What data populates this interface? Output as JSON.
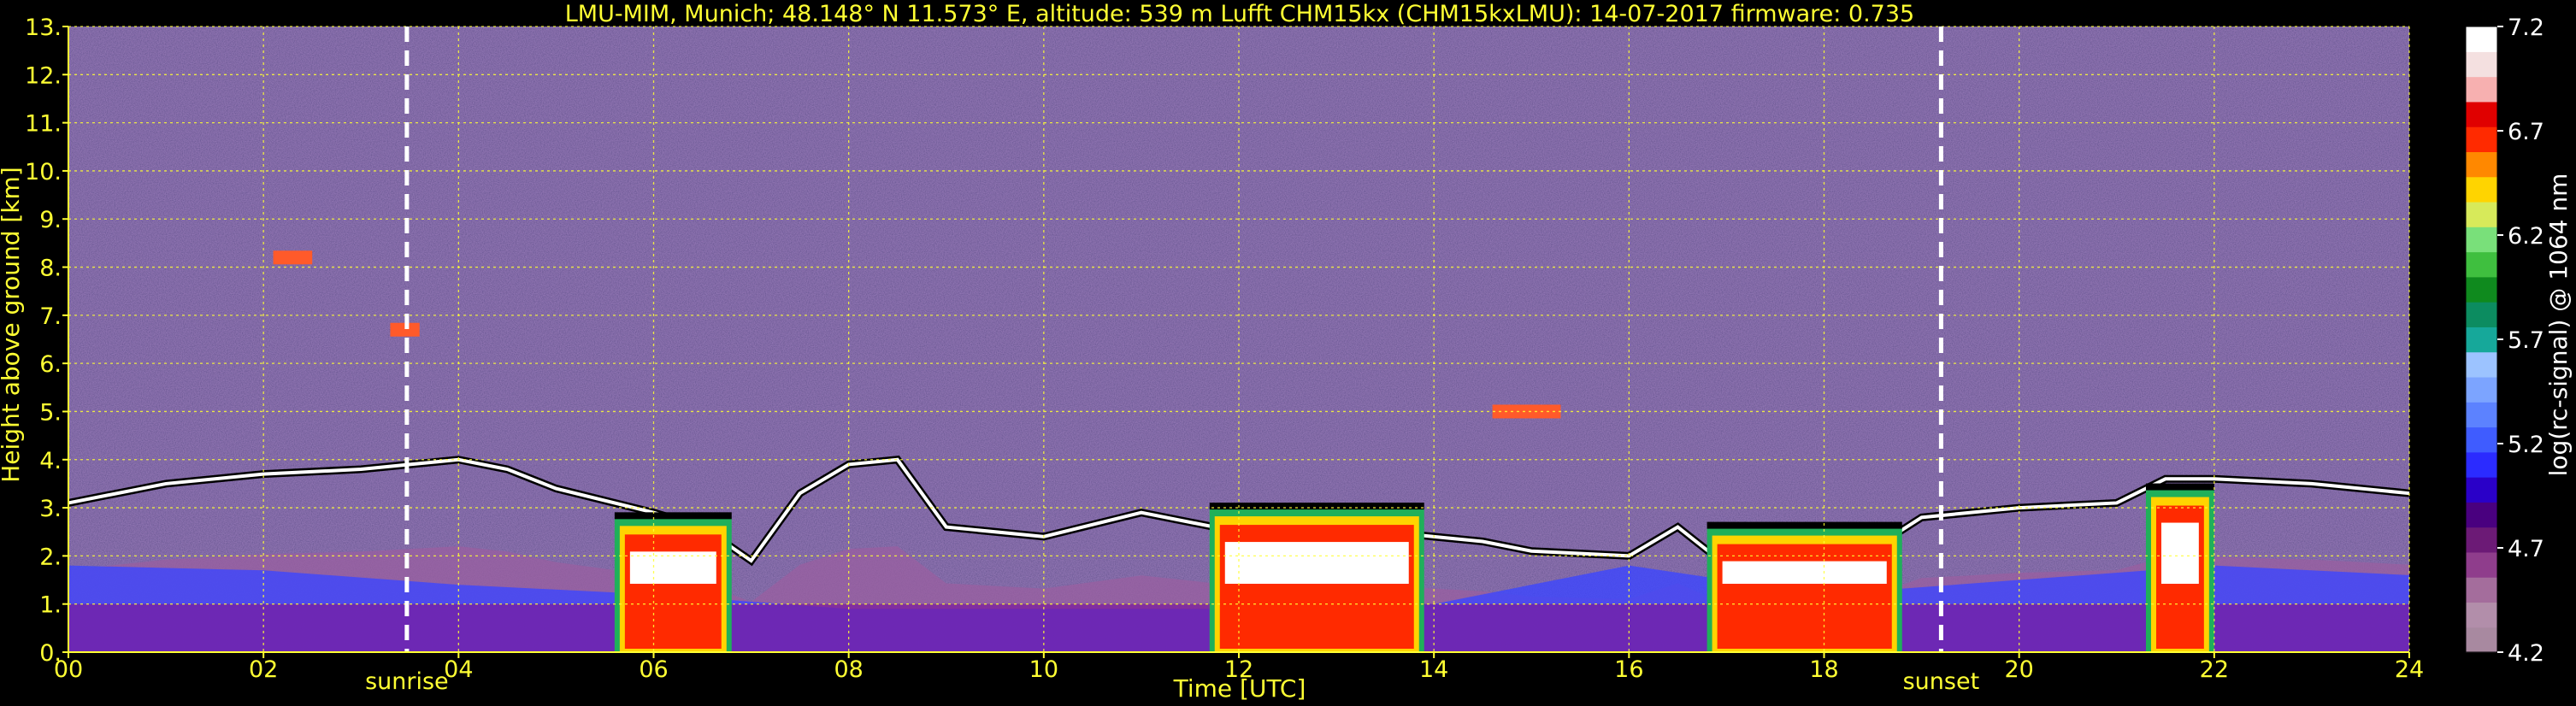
{
  "chart_data": {
    "type": "heatmap",
    "title": "LMU-MIM, Munich; 48.148° N 11.573° E, altitude: 539 m     Lufft CHM15kx (CHM15kxLMU): 14-07-2017     firmware: 0.735",
    "xlabel": "Time [UTC]",
    "ylabel": "Height above ground [km]",
    "xlim": [
      0,
      24
    ],
    "ylim": [
      0,
      13
    ],
    "x_ticks": [
      "00",
      "02",
      "04",
      "06",
      "08",
      "10",
      "12",
      "14",
      "16",
      "18",
      "20",
      "22",
      "24"
    ],
    "x_tick_values": [
      0,
      2,
      4,
      6,
      8,
      10,
      12,
      14,
      16,
      18,
      20,
      22,
      24
    ],
    "y_ticks": [
      "0.",
      "1.",
      "2.",
      "3.",
      "4.",
      "5.",
      "6.",
      "7.",
      "8.",
      "9.",
      "10.",
      "11.",
      "12.",
      "13."
    ],
    "y_tick_values": [
      0,
      1,
      2,
      3,
      4,
      5,
      6,
      7,
      8,
      9,
      10,
      11,
      12,
      13
    ],
    "grid": true,
    "annotations": [
      {
        "label": "sunrise",
        "x": 3.47
      },
      {
        "label": "sunset",
        "x": 19.2
      }
    ],
    "colorbar": {
      "label": "log(rc-signal) @ 1064 nm",
      "min": 4.2,
      "max": 7.2,
      "ticks": [
        "4.2",
        "4.7",
        "5.2",
        "5.7",
        "6.2",
        "6.7",
        "7.2"
      ],
      "tick_values": [
        4.2,
        4.7,
        5.2,
        5.7,
        6.2,
        6.7,
        7.2
      ],
      "colors": [
        "#a889a0",
        "#b28eaa",
        "#a46d9c",
        "#8f3d8c",
        "#6c1a76",
        "#49007f",
        "#2a00c8",
        "#2b2bff",
        "#3f5cff",
        "#5c82ff",
        "#7ca4ff",
        "#9cc3ff",
        "#16a89a",
        "#0c8c60",
        "#0f8a1e",
        "#3fbf3f",
        "#79e07a",
        "#d7ea5a",
        "#ffd400",
        "#ff8800",
        "#ff2a00",
        "#e00000",
        "#f7b0b0",
        "#f4e0e0",
        "#ffffff"
      ]
    },
    "features": {
      "boundary_layer_top_km": [
        [
          0,
          3.1
        ],
        [
          1,
          3.5
        ],
        [
          2,
          3.7
        ],
        [
          3,
          3.8
        ],
        [
          3.5,
          3.9
        ],
        [
          4,
          4.0
        ],
        [
          4.5,
          3.8
        ],
        [
          5,
          3.4
        ],
        [
          6,
          2.9
        ],
        [
          6.5,
          2.6
        ],
        [
          7,
          1.9
        ],
        [
          7.5,
          3.3
        ],
        [
          8,
          3.9
        ],
        [
          8.5,
          4.0
        ],
        [
          9,
          2.6
        ],
        [
          10,
          2.4
        ],
        [
          11,
          2.9
        ],
        [
          12,
          2.5
        ],
        [
          13,
          2.6
        ],
        [
          14,
          2.4
        ],
        [
          14.5,
          2.3
        ],
        [
          15,
          2.1
        ],
        [
          16,
          2.0
        ],
        [
          16.5,
          2.6
        ],
        [
          17,
          1.8
        ],
        [
          18,
          1.5
        ],
        [
          19,
          2.8
        ],
        [
          20,
          3.0
        ],
        [
          21,
          3.1
        ],
        [
          21.5,
          3.6
        ],
        [
          22,
          3.6
        ],
        [
          23,
          3.5
        ],
        [
          24,
          3.3
        ]
      ],
      "cloud_events": [
        {
          "t0": 5.6,
          "t1": 6.8,
          "top_km": 2.8
        },
        {
          "t0": 11.7,
          "t1": 13.9,
          "top_km": 3.0
        },
        {
          "t0": 16.8,
          "t1": 18.8,
          "top_km": 2.6
        },
        {
          "t0": 21.3,
          "t1": 22.0,
          "top_km": 3.4
        }
      ],
      "elevated_layers": [
        {
          "t0": 2.1,
          "t1": 2.5,
          "h_km": 8.2
        },
        {
          "t0": 3.3,
          "t1": 3.6,
          "h_km": 6.7
        },
        {
          "t0": 14.6,
          "t1": 15.3,
          "h_km": 5.0
        }
      ]
    }
  }
}
